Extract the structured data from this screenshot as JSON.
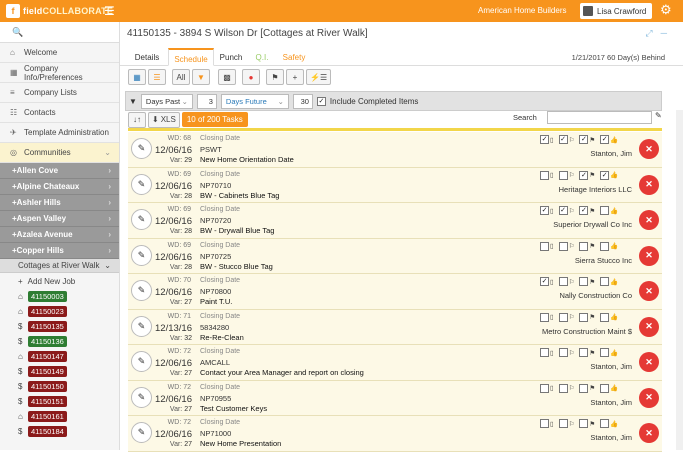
{
  "app": {
    "logo_letter": "f",
    "logo_a": "field",
    "logo_b": "COLLABORATE",
    "company": "American Home Builders",
    "user": "Lisa Crawford"
  },
  "sidebar": {
    "items": [
      {
        "label": "Welcome",
        "icon": "home-icon"
      },
      {
        "label": "Company Info/Preferences",
        "icon": "building-icon"
      },
      {
        "label": "Company Lists",
        "icon": "list-icon"
      },
      {
        "label": "Contacts",
        "icon": "contacts-icon"
      },
      {
        "label": "Template Administration",
        "icon": "wrench-icon"
      },
      {
        "label": "Communities",
        "icon": "globe-icon"
      }
    ],
    "communities": [
      "Allen Cove",
      "Alpine Chateaux",
      "Ashler Hills",
      "Aspen Valley",
      "Azalea Avenue",
      "Copper Hills"
    ],
    "selected_community": "Cottages at River Walk",
    "add_job": "Add New Job",
    "jobs": [
      {
        "id": "41150003",
        "color": "#2e7d32",
        "icon": "home"
      },
      {
        "id": "41150023",
        "color": "#8b1a1a",
        "icon": "home"
      },
      {
        "id": "41150135",
        "color": "#8b1a1a",
        "icon": "dollar"
      },
      {
        "id": "41150136",
        "color": "#2e7d32",
        "icon": "dollar"
      },
      {
        "id": "41150147",
        "color": "#8b1a1a",
        "icon": "home"
      },
      {
        "id": "41150149",
        "color": "#8b1a1a",
        "icon": "dollar"
      },
      {
        "id": "41150150",
        "color": "#8b1a1a",
        "icon": "dollar"
      },
      {
        "id": "41150151",
        "color": "#8b1a1a",
        "icon": "dollar"
      },
      {
        "id": "41150161",
        "color": "#8b1a1a",
        "icon": "home"
      },
      {
        "id": "41150184",
        "color": "#8b1a1a",
        "icon": "dollar"
      }
    ]
  },
  "page": {
    "title": "41150135 - 3894 S Wilson Dr [Cottages at River Walk]",
    "date_status": "1/21/2017 60 Day(s) Behind"
  },
  "tabs": [
    {
      "label": "Details",
      "color": "#555"
    },
    {
      "label": "Schedule",
      "color": "#f7941d"
    },
    {
      "label": "Punch",
      "color": "#555"
    },
    {
      "label": "Q.I.",
      "color": "#9c6"
    },
    {
      "label": "Safety",
      "color": "#f7941d"
    }
  ],
  "toolbar": {
    "all_label": "All"
  },
  "filter": {
    "days_past": "Days Past",
    "past_value": "3",
    "days_future": "Days Future",
    "future_value": "30",
    "include_completed": "Include Completed Items"
  },
  "toolbar2": {
    "xls": "XLS",
    "task_count": "10 of 200 Tasks",
    "search_label": "Search"
  },
  "tasks": [
    {
      "wd": "WD: 68",
      "date": "12/06/16",
      "var_label": "Var:",
      "var": "29",
      "type": "Closing Date",
      "code": "PSWT",
      "name": "New Home Orientation Date",
      "vendor": "Stanton, Jim",
      "checks": [
        true,
        true,
        true,
        true
      ]
    },
    {
      "wd": "WD: 69",
      "date": "12/06/16",
      "var_label": "Var:",
      "var": "28",
      "type": "Closing Date",
      "code": "NP70710",
      "name": "BW - Cabinets Blue Tag",
      "vendor": "Heritage Interiors LLC",
      "checks": [
        false,
        false,
        true,
        true
      ]
    },
    {
      "wd": "WD: 69",
      "date": "12/06/16",
      "var_label": "Var:",
      "var": "28",
      "type": "Closing Date",
      "code": "NP70720",
      "name": "BW - Drywall Blue Tag",
      "vendor": "Superior Drywall Co Inc",
      "checks": [
        true,
        true,
        true,
        false
      ]
    },
    {
      "wd": "WD: 69",
      "date": "12/06/16",
      "var_label": "Var:",
      "var": "28",
      "type": "Closing Date",
      "code": "NP70725",
      "name": "BW - Stucco Blue Tag",
      "vendor": "Sierra Stucco Inc",
      "checks": [
        false,
        false,
        false,
        false
      ]
    },
    {
      "wd": "WD: 70",
      "date": "12/06/16",
      "var_label": "Var:",
      "var": "27",
      "type": "Closing Date",
      "code": "NP70800",
      "name": "Paint T.U.",
      "vendor": "Nally Construction Co",
      "checks": [
        true,
        false,
        false,
        false
      ]
    },
    {
      "wd": "WD: 71",
      "date": "12/13/16",
      "var_label": "Var:",
      "var": "32",
      "type": "Closing Date",
      "code": "5834280",
      "name": "Re-Re-Clean",
      "vendor": "Metro Construction Maint $",
      "checks": [
        false,
        false,
        false,
        false
      ]
    },
    {
      "wd": "WD: 72",
      "date": "12/06/16",
      "var_label": "Var:",
      "var": "27",
      "type": "Closing Date",
      "code": "AMCALL",
      "name": "Contact your Area Manager and report on closing",
      "vendor": "Stanton, Jim",
      "checks": [
        false,
        false,
        false,
        false
      ]
    },
    {
      "wd": "WD: 72",
      "date": "12/06/16",
      "var_label": "Var:",
      "var": "27",
      "type": "Closing Date",
      "code": "NP70955",
      "name": "Test Customer Keys",
      "vendor": "Stanton, Jim",
      "checks": [
        false,
        false,
        false,
        false
      ]
    },
    {
      "wd": "WD: 72",
      "date": "12/06/16",
      "var_label": "Var:",
      "var": "27",
      "type": "Closing Date",
      "code": "NP71000",
      "name": "New Home Presentation",
      "vendor": "Stanton, Jim",
      "checks": [
        false,
        false,
        false,
        false
      ]
    }
  ]
}
